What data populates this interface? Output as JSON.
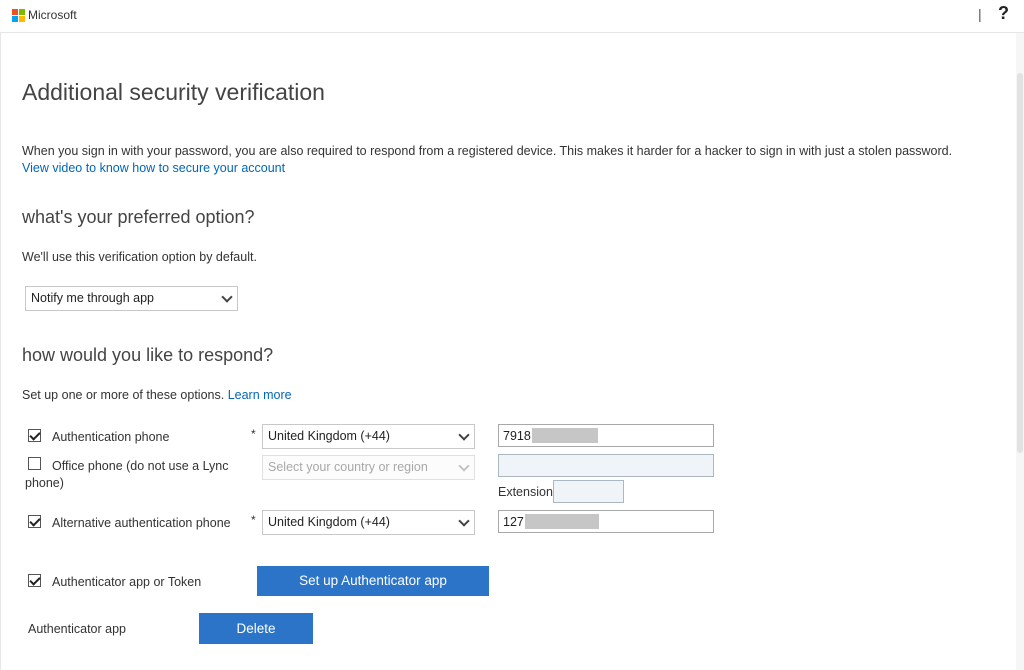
{
  "header": {
    "brand": "Microsoft",
    "separator": "|",
    "help_label": "?"
  },
  "page": {
    "title": "Additional security verification",
    "intro": "When you sign in with your password, you are also required to respond from a registered device. This makes it harder for a hacker to sign in with just a stolen password.",
    "video_link": "View video to know how to secure your account"
  },
  "preferred": {
    "heading": "what's your preferred option?",
    "hint": "We'll use this verification option by default.",
    "selected": "Notify me through app"
  },
  "respond": {
    "heading": "how would you like to respond?",
    "hint": "Set up one or more of these options.",
    "learn_more": "Learn more",
    "required_mark": "*",
    "auth_phone": {
      "checked": true,
      "label": "Authentication phone",
      "country": "United Kingdom (+44)",
      "number_visible": "7918"
    },
    "office_phone": {
      "checked": false,
      "label_line1": "Office phone (do not use a Lync",
      "label_line2": "phone)",
      "country_placeholder": "Select your country or region",
      "number": "",
      "extension_label": "Extension",
      "extension": ""
    },
    "alt_phone": {
      "checked": true,
      "label": "Alternative authentication phone",
      "country": "United Kingdom (+44)",
      "number_visible": "127"
    },
    "authenticator": {
      "checked": true,
      "label": "Authenticator app or Token",
      "setup_button": "Set up Authenticator app"
    },
    "registered_app": {
      "label": "Authenticator app",
      "delete_button": "Delete"
    }
  },
  "colors": {
    "accent_button": "#2b74c8",
    "link": "#0067b8"
  }
}
